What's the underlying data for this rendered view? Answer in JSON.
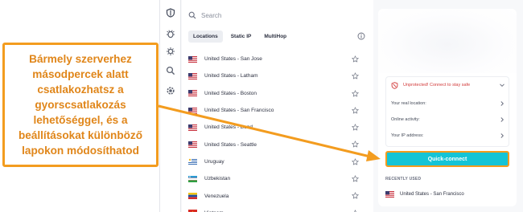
{
  "annotation": {
    "text": "Bármely szerverhez\nmásodpercek alatt\ncsatlakozhatsz a\ngyorscsatlakozás\nlehetőséggel, és a\nbeállításokat különböző\nlapokon módosíthatod"
  },
  "search": {
    "placeholder": "Search"
  },
  "tabs": [
    {
      "label": "Locations",
      "active": true
    },
    {
      "label": "Static IP",
      "active": false
    },
    {
      "label": "MultiHop",
      "active": false
    }
  ],
  "servers": [
    {
      "name": "United States - San Jose",
      "flag": "us"
    },
    {
      "name": "United States - Latham",
      "flag": "us"
    },
    {
      "name": "United States - Boston",
      "flag": "us"
    },
    {
      "name": "United States - San Francisco",
      "flag": "us"
    },
    {
      "name": "United States - Bend",
      "flag": "us"
    },
    {
      "name": "United States - Seattle",
      "flag": "us"
    },
    {
      "name": "Uruguay",
      "flag": "uy"
    },
    {
      "name": "Uzbekistan",
      "flag": "uz"
    },
    {
      "name": "Venezuela",
      "flag": "ve"
    },
    {
      "name": "Vietnam",
      "flag": "vn"
    }
  ],
  "status": {
    "unprotected": "Unprotected! Connect to stay safe",
    "real_location": "Your real location:",
    "online_activity": "Online activity:",
    "ip_address": "Your IP address:"
  },
  "quick_connect": {
    "label": "Quick-connect"
  },
  "recent": {
    "heading": "RECENTLY USED",
    "items": [
      {
        "name": "United States - San Francisco",
        "flag": "us"
      }
    ]
  },
  "colors": {
    "accent": "#14c4d6",
    "annotation": "#f39c1f",
    "danger": "#d23a3a"
  },
  "icons": {
    "rail": [
      "shield-icon",
      "bug-icon",
      "gear-sparkle-icon",
      "search-globe-icon",
      "settings-icon"
    ],
    "search": "search-icon",
    "info": "info-icon",
    "favorite": "star-icon"
  }
}
